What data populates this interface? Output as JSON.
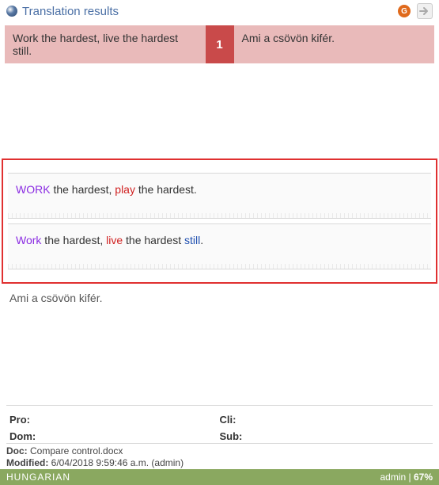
{
  "header": {
    "title": "Translation results",
    "g_label": "G"
  },
  "match": {
    "source": "Work the hardest, live the hardest still.",
    "score": "1",
    "target": "Ami a csövön kifér."
  },
  "segments": [
    {
      "tokens": [
        {
          "t": "WORK",
          "cls": "w-purple"
        },
        {
          "t": " the hardest",
          "cls": "w-plain"
        },
        {
          "t": ", ",
          "cls": "w-plain"
        },
        {
          "t": "play",
          "cls": "w-red"
        },
        {
          "t": " the hardest",
          "cls": "w-plain"
        },
        {
          "t": ".",
          "cls": "w-plain"
        }
      ]
    },
    {
      "tokens": [
        {
          "t": "Work",
          "cls": "w-purple"
        },
        {
          "t": " the hardest",
          "cls": "w-plain"
        },
        {
          "t": ", ",
          "cls": "w-plain"
        },
        {
          "t": "live",
          "cls": "w-red"
        },
        {
          "t": " the hardest ",
          "cls": "w-plain"
        },
        {
          "t": "still",
          "cls": "w-blue"
        },
        {
          "t": ".",
          "cls": "w-plain"
        }
      ]
    }
  ],
  "target_line": "Ami a csövön kifér.",
  "meta": {
    "pro_label": "Pro:",
    "dom_label": "Dom:",
    "cli_label": "Cli:",
    "sub_label": "Sub:"
  },
  "doc": {
    "doc_label": "Doc:",
    "doc_value": " Compare control.docx",
    "mod_label": "Modified:",
    "mod_value": " 6/04/2018 9:59:46 a.m. (admin)"
  },
  "status": {
    "lang": "HUNGARIAN",
    "user": "admin",
    "sep": " | ",
    "pct": "67%"
  }
}
